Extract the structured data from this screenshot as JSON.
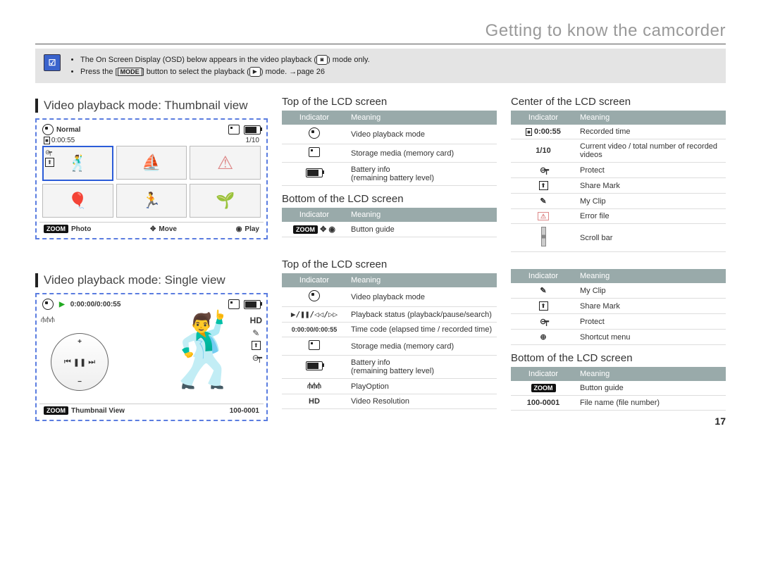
{
  "title": "Getting to know the camcorder",
  "page_number": "17",
  "notes": {
    "bullet1_a": "The On Screen Display (OSD) below appears in the video playback (",
    "bullet1_b": ") mode only.",
    "bullet2_a": "Press the [",
    "bullet2_mode": "MODE",
    "bullet2_b": "] button to select the playback (",
    "bullet2_c": ") mode. ",
    "bullet2_page": "page 26"
  },
  "section1": "Video playback mode: Thumbnail view",
  "section2": "Video playback mode: Single view",
  "thumb_lcd": {
    "normal": "Normal",
    "time": "0:00:55",
    "counter": "1/10",
    "guide_photo": "Photo",
    "guide_move": "Move",
    "guide_play": "Play",
    "zoom": "ZOOM"
  },
  "single_lcd": {
    "time": "0:00:00/0:00:55",
    "guide_thumb": "Thumbnail View",
    "file": "100-0001",
    "zoom": "ZOOM",
    "hd": "HD"
  },
  "tables": {
    "th_indicator": "Indicator",
    "th_meaning": "Meaning",
    "t1_title": "Top of the LCD screen",
    "t1": [
      {
        "m": "Video playback mode"
      },
      {
        "m": "Storage media (memory card)"
      },
      {
        "m": "Battery info\n(remaining battery level)"
      }
    ],
    "t2_title": "Bottom of the LCD screen",
    "t2": [
      {
        "m": "Button guide"
      }
    ],
    "t3_title": "Center of the LCD screen",
    "t3": [
      {
        "i": "0:00:55",
        "m": "Recorded time"
      },
      {
        "i": "1/10",
        "m": "Current video / total number of recorded videos"
      },
      {
        "i": "lock",
        "m": "Protect"
      },
      {
        "i": "share",
        "m": "Share Mark"
      },
      {
        "i": "clip",
        "m": "My Clip"
      },
      {
        "i": "warn",
        "m": "Error file"
      },
      {
        "i": "scroll",
        "m": "Scroll bar"
      }
    ],
    "t4_title": "Top of the LCD screen",
    "t4": [
      {
        "m": "Video playback mode"
      },
      {
        "m": "Playback status (playback/pause/search)",
        "i": "▶/❚❚/◁◁/▷▷"
      },
      {
        "m": "Time code (elapsed time / recorded time)",
        "i": "0:00:00/0:00:55"
      },
      {
        "m": "Storage media (memory card)"
      },
      {
        "m": "Battery info\n(remaining battery level)"
      },
      {
        "m": "PlayOption"
      },
      {
        "m": "Video Resolution",
        "i": "HD"
      }
    ],
    "t5": [
      {
        "i": "clip",
        "m": "My Clip"
      },
      {
        "i": "share",
        "m": "Share Mark"
      },
      {
        "i": "lock",
        "m": "Protect"
      },
      {
        "i": "menu",
        "m": "Shortcut menu"
      }
    ],
    "t6_title": "Bottom of the LCD screen",
    "t6": [
      {
        "i": "zoom",
        "m": "Button guide"
      },
      {
        "i": "100-0001",
        "m": "File name (file number)"
      }
    ]
  }
}
